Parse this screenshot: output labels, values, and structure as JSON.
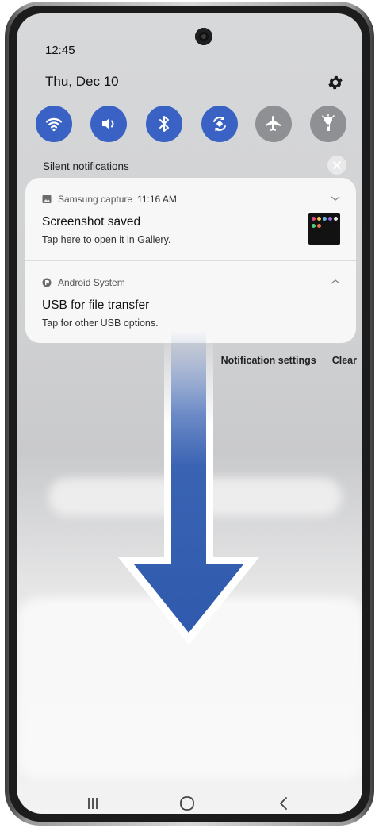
{
  "status_bar": {
    "time": "12:45"
  },
  "header": {
    "date": "Thu, Dec 10",
    "settings_icon": "gear-icon"
  },
  "quick_settings": [
    {
      "name": "wifi",
      "icon": "wifi-icon",
      "state": "on"
    },
    {
      "name": "sound",
      "icon": "sound-icon",
      "state": "on"
    },
    {
      "name": "bluetooth",
      "icon": "bluetooth-icon",
      "state": "on"
    },
    {
      "name": "auto-rotate",
      "icon": "rotate-icon",
      "state": "on"
    },
    {
      "name": "airplane-mode",
      "icon": "airplane-icon",
      "state": "off"
    },
    {
      "name": "flashlight",
      "icon": "flashlight-icon",
      "state": "off"
    }
  ],
  "silent_section": {
    "label": "Silent notifications"
  },
  "notifications": [
    {
      "app": "Samsung capture",
      "time": "11:16 AM",
      "title": "Screenshot saved",
      "body": "Tap here to open it in Gallery.",
      "app_icon": "image-icon",
      "expand_icon": "chevron-down-icon"
    },
    {
      "app": "Android System",
      "title": "USB for file transfer",
      "body": "Tap for other USB options.",
      "app_icon": "android-system-icon",
      "expand_icon": "chevron-up-icon"
    }
  ],
  "actions": {
    "settings": "Notification settings",
    "clear": "Clear"
  },
  "navigation": {
    "recents_icon": "recents-icon",
    "home_icon": "home-icon",
    "back_icon": "back-icon"
  },
  "colors": {
    "accent": "#3a62c4",
    "toggle_off": "#8f9093",
    "arrow": "#3a63b3"
  }
}
